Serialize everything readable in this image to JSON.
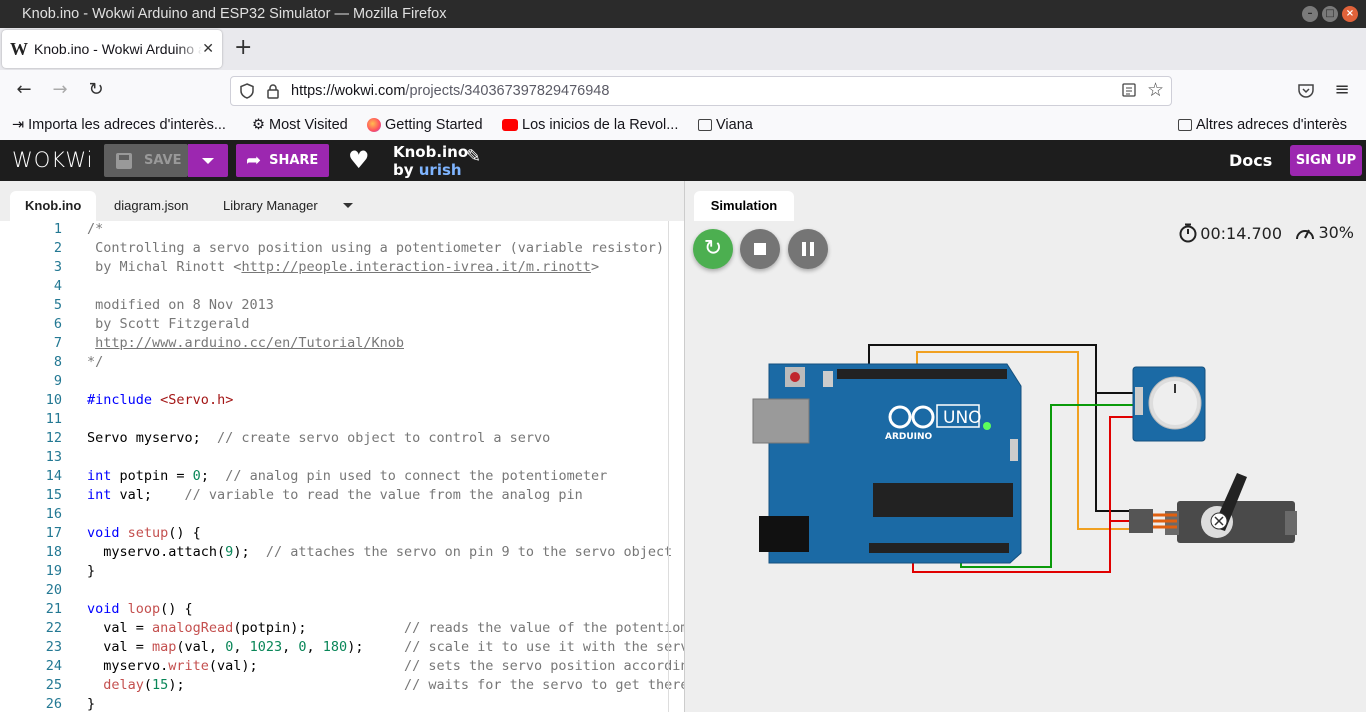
{
  "window": {
    "title": "Knob.ino - Wokwi Arduino and ESP32 Simulator — Mozilla Firefox"
  },
  "browser": {
    "tab_title": "Knob.ino - Wokwi Arduino and ESP32 Simulator",
    "tab_favicon": "W",
    "url_host": "https://wokwi.com",
    "url_path": "/projects/340367397829476948",
    "bookmarks": [
      {
        "label": "Importa les adreces d'interès...",
        "icon": "import-icon"
      },
      {
        "label": "Most Visited",
        "icon": "gear-icon"
      },
      {
        "label": "Getting Started",
        "icon": "firefox-icon"
      },
      {
        "label": "Los inicios de la Revol...",
        "icon": "youtube-icon"
      },
      {
        "label": "Viana",
        "icon": "folder-icon"
      }
    ],
    "other_bookmarks": "Altres adreces d'interès"
  },
  "wokwi": {
    "logo": "WOKWi",
    "save_label": "SAVE",
    "share_label": "SHARE",
    "project_name": "Knob.ino",
    "by_label": "by",
    "author": "urish",
    "docs_label": "Docs",
    "signup_label": "SIGN UP"
  },
  "editor": {
    "tabs": [
      "Knob.ino",
      "diagram.json",
      "Library Manager"
    ],
    "active_tab": "Knob.ino",
    "line_numbers": [
      "1",
      "2",
      "3",
      "4",
      "5",
      "6",
      "7",
      "8",
      "9",
      "10",
      "11",
      "12",
      "13",
      "14",
      "15",
      "16",
      "17",
      "18",
      "19",
      "20",
      "21",
      "22",
      "23",
      "24",
      "25",
      "26"
    ]
  },
  "simulation": {
    "tab_label": "Simulation",
    "timer": "00:14.700",
    "speed": "30%",
    "board_label": "UNO",
    "board_brand": "ARDUINO"
  },
  "colors": {
    "accent": "#9c27b0",
    "header_bg": "#1d1d1d",
    "restart_green": "#4caf50",
    "board_blue": "#1b6aa5"
  }
}
